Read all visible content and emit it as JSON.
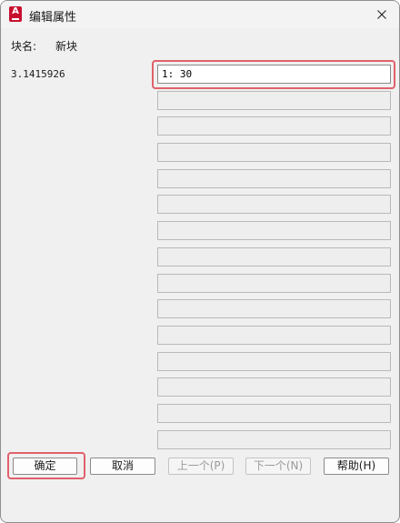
{
  "window": {
    "title": "编辑属性",
    "app_icon": "autocad-icon",
    "close_icon": "close-icon"
  },
  "block": {
    "label": "块名:",
    "name": "新块"
  },
  "attribute": {
    "prompt": "3.1415926",
    "value": "1: 30",
    "empty_field_count": 14
  },
  "buttons": {
    "ok": "确定",
    "cancel": "取消",
    "prev": "上一个(P)",
    "next": "下一个(N)",
    "help": "帮助(H)"
  },
  "colors": {
    "highlight": "#e0616b",
    "app_icon": "#c8102e"
  }
}
